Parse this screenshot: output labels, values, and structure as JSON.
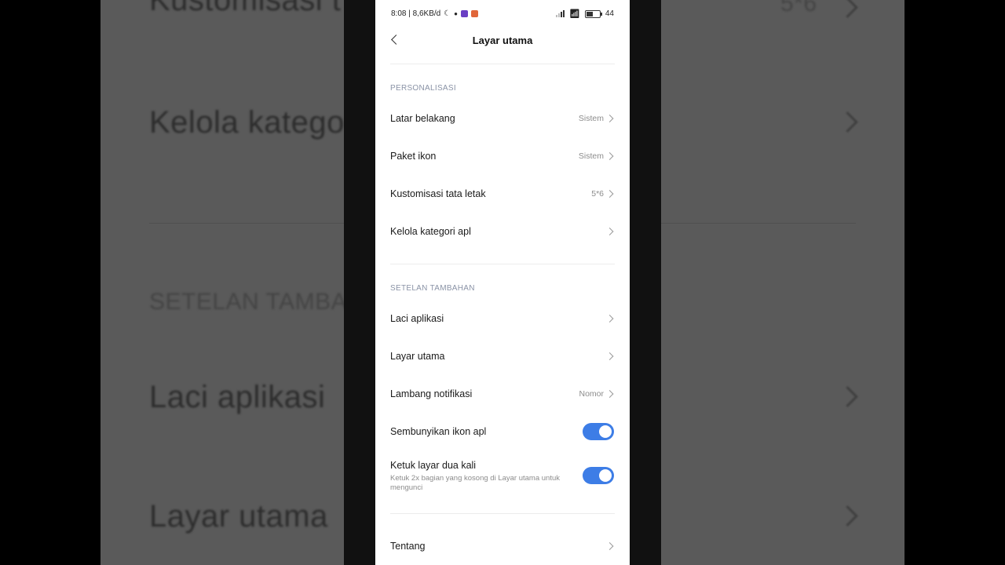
{
  "background": {
    "texts": [
      "Kustomisasi t",
      "5*6",
      "Kelola katego",
      "SETELAN TAMBA",
      "Laci aplikasi",
      "Layar utama"
    ]
  },
  "status_bar": {
    "time_speed": "8:08 | 8,6KB/d",
    "battery": "44",
    "battery_level": 0.44
  },
  "header": {
    "title": "Layar utama"
  },
  "sections": [
    {
      "title": "PERSONALISASI",
      "items": [
        {
          "label": "Latar belakang",
          "value": "Sistem"
        },
        {
          "label": "Paket ikon",
          "value": "Sistem"
        },
        {
          "label": "Kustomisasi tata letak",
          "value": "5*6"
        },
        {
          "label": "Kelola kategori apl",
          "value": ""
        }
      ]
    },
    {
      "title": "SETELAN TAMBAHAN",
      "items": [
        {
          "label": "Laci aplikasi",
          "value": ""
        },
        {
          "label": "Layar utama",
          "value": ""
        },
        {
          "label": "Lambang notifikasi",
          "value": "Nomor"
        },
        {
          "label": "Sembunyikan ikon apl",
          "toggle": true
        },
        {
          "label": "Ketuk layar dua kali",
          "description": "Ketuk 2x bagian yang kosong di Layar utama untuk mengunci",
          "toggle": true
        }
      ]
    },
    {
      "title": "",
      "items": [
        {
          "label": "Tentang",
          "value": ""
        }
      ]
    }
  ],
  "colors": {
    "accent": "#3d7de6",
    "section_title": "#8a93a6"
  }
}
